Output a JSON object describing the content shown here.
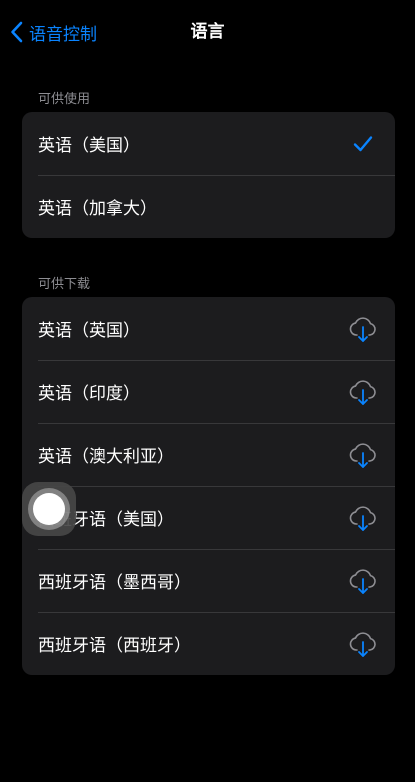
{
  "nav": {
    "back_label": "语音控制",
    "title": "语言"
  },
  "sections": {
    "available": {
      "header": "可供使用",
      "items": [
        {
          "label": "英语（美国）",
          "selected": true
        },
        {
          "label": "英语（加拿大）",
          "selected": false
        }
      ]
    },
    "downloadable": {
      "header": "可供下载",
      "items": [
        {
          "label": "英语（英国）"
        },
        {
          "label": "英语（印度）"
        },
        {
          "label": "英语（澳大利亚）"
        },
        {
          "label": "西班牙语（美国）"
        },
        {
          "label": "西班牙语（墨西哥）"
        },
        {
          "label": "西班牙语（西班牙）"
        }
      ]
    }
  },
  "colors": {
    "accent": "#0a84ff",
    "background": "#000000",
    "cell": "#1c1c1e",
    "separator": "#38383a",
    "secondary_text": "#8d8d92"
  },
  "icons": {
    "back": "chevron-left-icon",
    "selected": "checkmark-icon",
    "download": "cloud-download-icon"
  }
}
